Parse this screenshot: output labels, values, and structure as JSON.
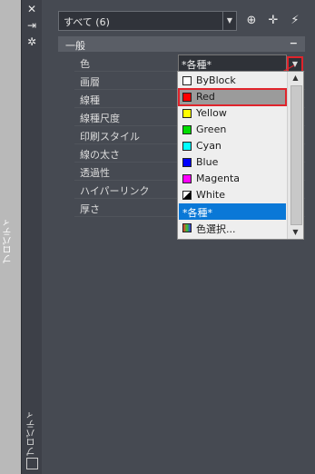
{
  "left_strip": {
    "label": "プロパティ"
  },
  "title_bar": {
    "label": "プロパティ"
  },
  "selector": {
    "value": "すべて (6)"
  },
  "section": {
    "title": "一般",
    "collapse": "−"
  },
  "properties": [
    {
      "label": "色"
    },
    {
      "label": "画層"
    },
    {
      "label": "線種"
    },
    {
      "label": "線種尺度"
    },
    {
      "label": "印刷スタイル"
    },
    {
      "label": "線の太さ"
    },
    {
      "label": "透過性"
    },
    {
      "label": "ハイパーリンク"
    },
    {
      "label": "厚さ"
    }
  ],
  "color_value": "*各種*",
  "color_options": [
    {
      "label": "ByBlock",
      "color": "#ffffff"
    },
    {
      "label": "Red",
      "color": "#ff0000"
    },
    {
      "label": "Yellow",
      "color": "#ffff00"
    },
    {
      "label": "Green",
      "color": "#00dd00"
    },
    {
      "label": "Cyan",
      "color": "#00ffff"
    },
    {
      "label": "Blue",
      "color": "#0000ff"
    },
    {
      "label": "Magenta",
      "color": "#ff00ff"
    },
    {
      "label": "White",
      "color": "#ffffff"
    },
    {
      "label": "*各種*",
      "color": ""
    },
    {
      "label": "色選択...",
      "color": ""
    }
  ],
  "accent_colors": {
    "highlight_outline": "#e0242c",
    "selection": "#0a78d7"
  }
}
